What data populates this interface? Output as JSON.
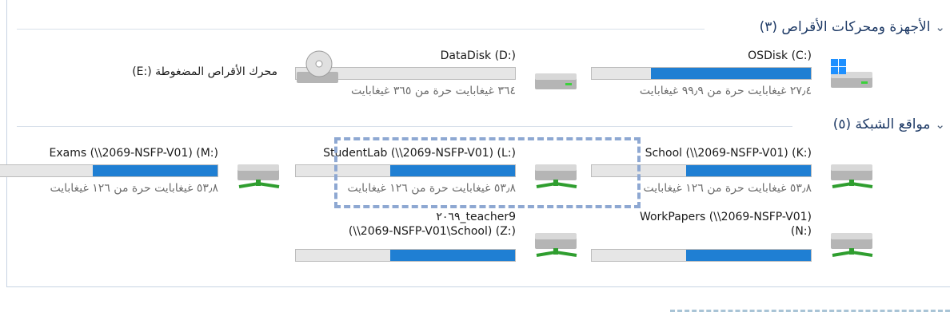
{
  "groups": {
    "devices": {
      "title": "الأجهزة ومحركات الأقراص (٣)"
    },
    "network": {
      "title": "مواقع الشبكة (٥)"
    }
  },
  "drives": {
    "c": {
      "name": "OSDisk (C:)",
      "free": "٢٧٫٤ غيغابايت حرة من ٩٩٫٩ غيغابايت",
      "used_fraction": 0.73
    },
    "d": {
      "name": "DataDisk (D:)",
      "free": "٣٦٤ غيغابايت حرة من ٣٦٥ غيغابايت",
      "used_fraction": 0.0
    },
    "e": {
      "name": "(E:) محرك الأقراص المضغوطة"
    },
    "k": {
      "name": "School (\\\\2069-NSFP-V01) (K:)",
      "free": "٥٣٫٨ غيغابايت حرة من ١٢٦ غيغابايت",
      "used_fraction": 0.57
    },
    "l": {
      "name": "StudentLab (\\\\2069-NSFP-V01) (L:)",
      "free": "٥٣٫٨ غيغابايت حرة من ١٢٦ غيغابايت",
      "used_fraction": 0.57
    },
    "m": {
      "name": "Exams (\\\\2069-NSFP-V01) (M:)",
      "free": "٥٣٫٨ غيغابايت حرة من ١٢٦ غيغابايت",
      "used_fraction": 0.57
    },
    "n": {
      "name_line1": "WorkPapers (\\\\2069-NSFP-V01)",
      "name_line2": "(N:)",
      "used_fraction": 0.57
    },
    "z": {
      "name_line1": "٢٠٦٩_teacher9",
      "name_line2": "(\\\\2069-NSFP-V01\\School) (Z:)",
      "used_fraction": 0.57
    }
  },
  "colors": {
    "bar_fill": "#1f7fd3",
    "bar_bg": "#e6e6e6",
    "header_text": "#1e3a66"
  }
}
